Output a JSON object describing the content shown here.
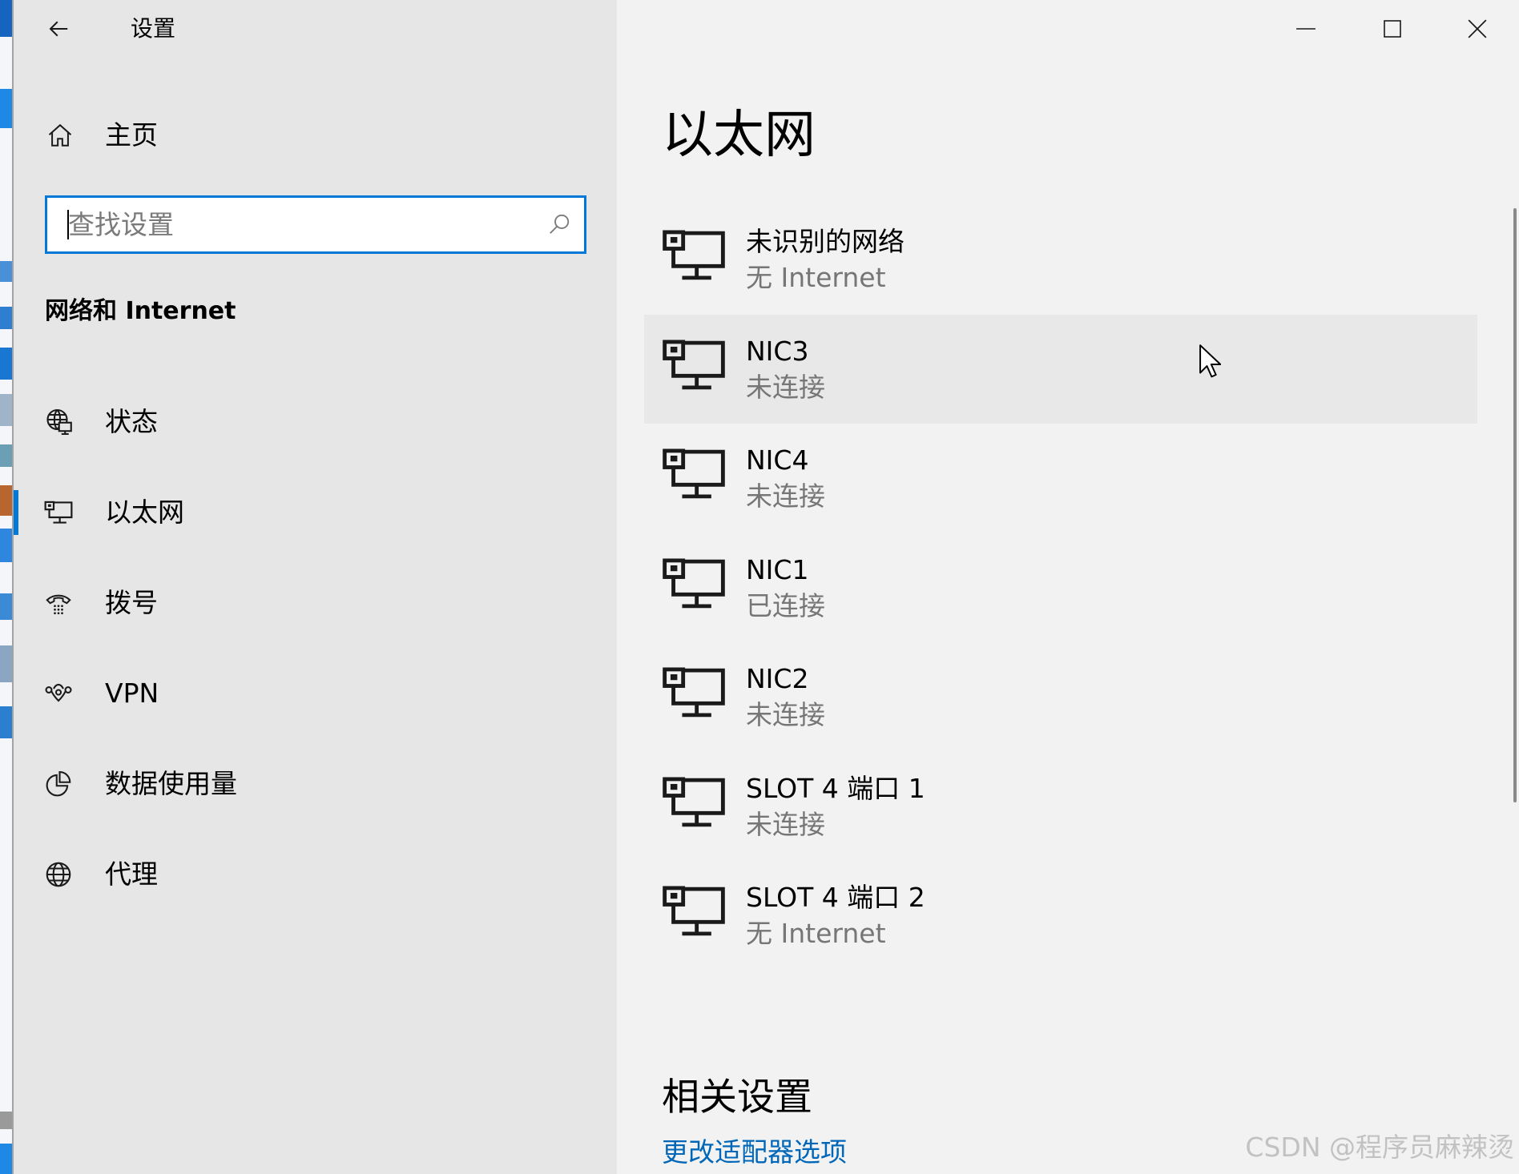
{
  "window": {
    "title": "设置",
    "back_icon": "back-arrow-icon",
    "controls": {
      "minimize_icon": "minimize-icon",
      "maximize_icon": "maximize-icon",
      "close_icon": "close-icon"
    }
  },
  "sidebar": {
    "home": {
      "label": "主页",
      "icon": "home-icon"
    },
    "search": {
      "placeholder": "查找设置",
      "icon": "search-icon",
      "focused": true
    },
    "section_title": "网络和 Internet",
    "items": [
      {
        "label": "状态",
        "icon": "network-status-icon",
        "selected": false
      },
      {
        "label": "以太网",
        "icon": "ethernet-icon",
        "selected": true
      },
      {
        "label": "拨号",
        "icon": "dial-up-icon",
        "selected": false
      },
      {
        "label": "VPN",
        "icon": "vpn-icon",
        "selected": false
      },
      {
        "label": "数据使用量",
        "icon": "data-usage-icon",
        "selected": false
      },
      {
        "label": "代理",
        "icon": "proxy-icon",
        "selected": false
      }
    ]
  },
  "main": {
    "title": "以太网",
    "network_icon": "ethernet-network-icon",
    "networks": [
      {
        "name": "未识别的网络",
        "status": "无 Internet",
        "hovered": false
      },
      {
        "name": "NIC3",
        "status": "未连接",
        "hovered": true
      },
      {
        "name": "NIC4",
        "status": "未连接",
        "hovered": false
      },
      {
        "name": "NIC1",
        "status": "已连接",
        "hovered": false
      },
      {
        "name": "NIC2",
        "status": "未连接",
        "hovered": false
      },
      {
        "name": "SLOT 4 端口 1",
        "status": "未连接",
        "hovered": false
      },
      {
        "name": "SLOT 4 端口 2",
        "status": "无 Internet",
        "hovered": false
      }
    ],
    "related_settings": {
      "heading": "相关设置",
      "links": [
        "更改适配器选项"
      ]
    }
  },
  "overlay": {
    "cursor_icon": "mouse-pointer-icon",
    "watermark": "CSDN @程序员麻辣烫"
  },
  "colors": {
    "accent": "#0078d7",
    "link": "#0067b8",
    "sidebar_bg": "#e6e6e6",
    "content_bg": "#f2f2f2",
    "hover_bg": "#e8e8e8",
    "secondary_text": "#767676"
  }
}
